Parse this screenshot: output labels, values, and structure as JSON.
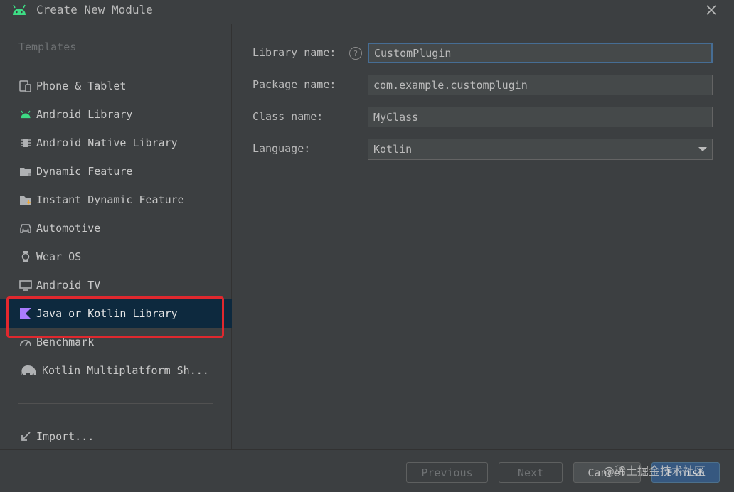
{
  "window": {
    "title": "Create New Module"
  },
  "sidebar": {
    "heading": "Templates",
    "items": [
      {
        "label": "Phone & Tablet",
        "icon": "phone-tablet-icon"
      },
      {
        "label": "Android Library",
        "icon": "android-icon"
      },
      {
        "label": "Android Native Library",
        "icon": "chip-icon"
      },
      {
        "label": "Dynamic Feature",
        "icon": "folder-icon"
      },
      {
        "label": "Instant Dynamic Feature",
        "icon": "folder-lightning-icon"
      },
      {
        "label": "Automotive",
        "icon": "car-icon"
      },
      {
        "label": "Wear OS",
        "icon": "watch-icon"
      },
      {
        "label": "Android TV",
        "icon": "tv-icon"
      },
      {
        "label": "Java or Kotlin Library",
        "icon": "kotlin-icon",
        "selected": true
      },
      {
        "label": "Benchmark",
        "icon": "gauge-icon"
      },
      {
        "label": "Kotlin Multiplatform Sh...",
        "icon": "elephant-icon"
      }
    ],
    "import_label": "Import..."
  },
  "form": {
    "library_name": {
      "label": "Library name:",
      "value": "CustomPlugin"
    },
    "package_name": {
      "label": "Package name:",
      "value": "com.example.customplugin"
    },
    "class_name": {
      "label": "Class name:",
      "value": "MyClass"
    },
    "language": {
      "label": "Language:",
      "value": "Kotlin"
    }
  },
  "footer": {
    "previous": "Previous",
    "next": "Next",
    "cancel": "Cancel",
    "finish": "Finish",
    "watermark": "@稀土掘金技术社区"
  },
  "colors": {
    "background": "#3c3f41",
    "selected_row": "#0d293e",
    "highlight_box": "#e0282e",
    "android_green": "#3ddc84",
    "kotlin_purple": "#a97bff",
    "primary_button": "#365880"
  }
}
